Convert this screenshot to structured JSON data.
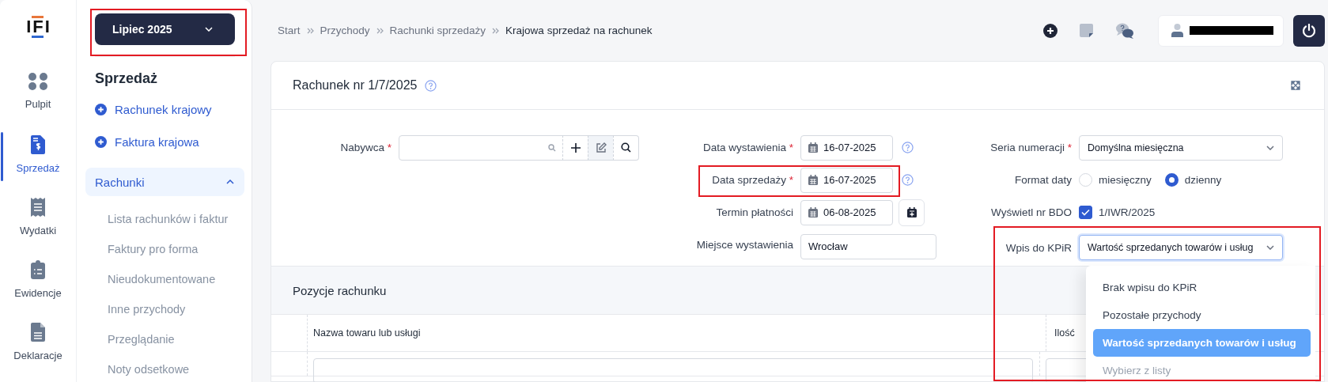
{
  "logo": {
    "text": "IFI"
  },
  "nav_rail": [
    {
      "label": "Pulpit",
      "selected": false
    },
    {
      "label": "Sprzedaż",
      "selected": true
    },
    {
      "label": "Wydatki",
      "selected": false
    },
    {
      "label": "Ewidencje",
      "selected": false
    },
    {
      "label": "Deklaracje",
      "selected": false
    }
  ],
  "month_picker": {
    "label": "Lipiec 2025",
    "highlighted": true
  },
  "sidebar": {
    "title": "Sprzedaż",
    "actions": [
      "Rachunek krajowy",
      "Faktura krajowa"
    ],
    "group": {
      "label": "Rachunki",
      "expanded": true,
      "items": [
        "Lista rachunków i faktur",
        "Faktury pro forma",
        "Nieudokumentowane",
        "Inne przychody",
        "Przeglądanie",
        "Noty odsetkowe"
      ]
    }
  },
  "breadcrumb": [
    {
      "label": "Start",
      "current": false
    },
    {
      "label": "Przychody",
      "current": false
    },
    {
      "label": "Rachunki sprzedaży",
      "current": false
    },
    {
      "label": "Krajowa sprzedaż na rachunek",
      "current": true
    }
  ],
  "card": {
    "title": "Rachunek nr 1/7/2025"
  },
  "buyer": {
    "label": "Nabywca",
    "required_mark": "*"
  },
  "dates": [
    {
      "label": "Data wystawienia",
      "required_mark": "*",
      "value": "16-07-2025",
      "kind": "date",
      "help": true,
      "highlighted": false
    },
    {
      "label": "Data sprzedaży",
      "required_mark": "*",
      "value": "16-07-2025",
      "kind": "date",
      "help": true,
      "highlighted": true
    },
    {
      "label": "Termin płatności",
      "value": "06-08-2025",
      "kind": "date-add",
      "help": false,
      "highlighted": false
    },
    {
      "label": "Miejsce wystawienia",
      "value": "Wrocław",
      "kind": "text",
      "help": false,
      "highlighted": false
    }
  ],
  "numbering": {
    "label": "Seria numeracji",
    "required_mark": "*",
    "value": "Domyślna miesięczna"
  },
  "date_format": {
    "label": "Format daty",
    "options": [
      {
        "label": "miesięczny",
        "selected": false
      },
      {
        "label": "dzienny",
        "selected": true
      }
    ]
  },
  "bdo": {
    "label": "Wyświetl nr BDO",
    "checked": true,
    "value": "1/IWR/2025"
  },
  "kpir": {
    "label": "Wpis do KPiR",
    "value": "Wartość sprzedanych towarów i usług",
    "expanded": true,
    "highlighted": true,
    "options": [
      {
        "label": "Brak wpisu do KPiR",
        "selected": false,
        "kind": "option"
      },
      {
        "label": "Pozostałe przychody",
        "selected": false,
        "kind": "option"
      },
      {
        "label": "Wartość sprzedanych towarów i usług",
        "selected": true,
        "kind": "option"
      },
      {
        "label": "Wybierz z listy",
        "kind": "placeholder"
      }
    ]
  },
  "items_section": {
    "title": "Pozycje rachunku",
    "columns": [
      "Nazwa towaru lub usługi",
      "Ilość"
    ]
  }
}
